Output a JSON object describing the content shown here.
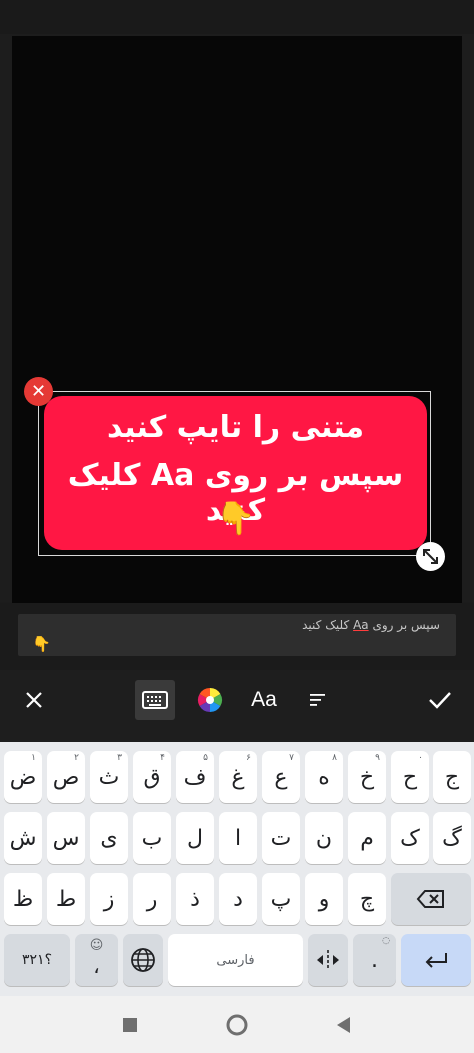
{
  "sticker": {
    "line1": "متنی را تایپ کنید",
    "line2": "سپس بر روی Aa کلیک کنید",
    "emoji": "👇"
  },
  "text_input": {
    "line1_before": "سپس بر روی ",
    "line1_aa": "Aa",
    "line1_after": " کلیک کنید",
    "line2": "👇"
  },
  "toolbar": {
    "aa_label": "Aa"
  },
  "keyboard": {
    "language_label": "فارسی",
    "symbols_label": "؟۳۲۱",
    "row1": [
      {
        "char": "ض",
        "hint": "۱"
      },
      {
        "char": "ص",
        "hint": "۲"
      },
      {
        "char": "ث",
        "hint": "۳"
      },
      {
        "char": "ق",
        "hint": "۴"
      },
      {
        "char": "ف",
        "hint": "۵"
      },
      {
        "char": "غ",
        "hint": "۶"
      },
      {
        "char": "ع",
        "hint": "۷"
      },
      {
        "char": "ه",
        "hint": "۸"
      },
      {
        "char": "خ",
        "hint": "۹"
      },
      {
        "char": "ح",
        "hint": "۰"
      },
      {
        "char": "ج",
        "hint": ""
      }
    ],
    "row2": [
      "ش",
      "س",
      "ی",
      "ب",
      "ل",
      "ا",
      "ت",
      "ن",
      "م",
      "ک",
      "گ"
    ],
    "row3": [
      "ظ",
      "ط",
      "ز",
      "ر",
      "ذ",
      "د",
      "پ",
      "و",
      "چ"
    ],
    "comma": "،",
    "period": "."
  },
  "colors": {
    "sticker_bg": "#ff1744",
    "delete_handle": "#e53935",
    "enter_key": "#c7d9f7"
  }
}
